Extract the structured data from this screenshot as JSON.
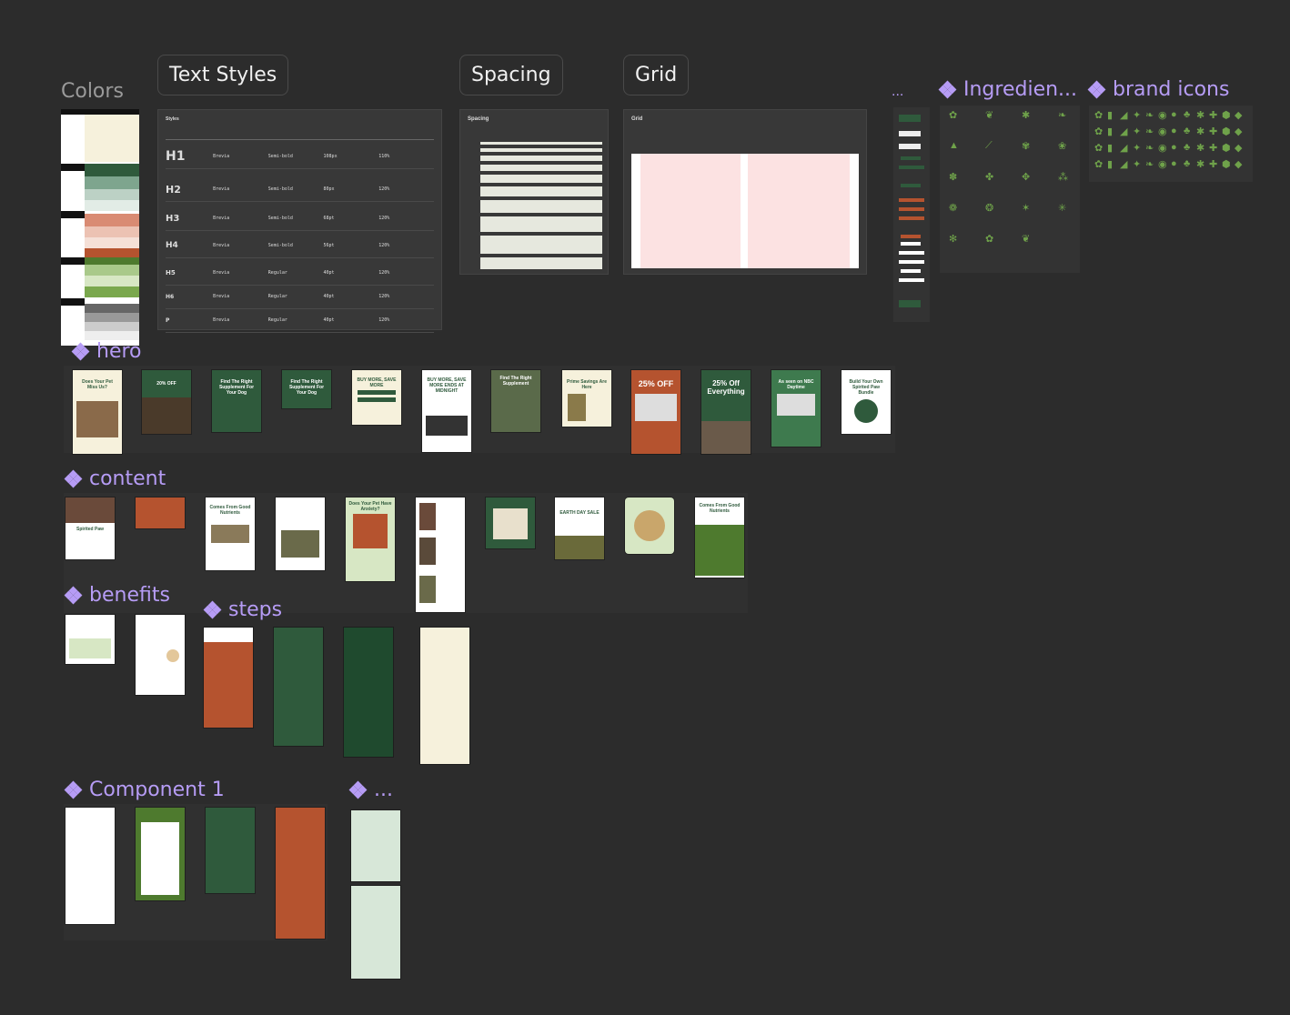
{
  "sections": {
    "colors": "Colors",
    "text_styles": "Text Styles",
    "spacing": "Spacing",
    "grid": "Grid",
    "more_top": "...",
    "ingredients": "Ingredien...",
    "brand_icons": "brand icons",
    "hero": "hero",
    "content": "content",
    "benefits": "benefits",
    "steps": "steps",
    "component1": "Component 1",
    "more_bottom": "..."
  },
  "text_styles_panel": {
    "title": "Styles",
    "rows": [
      {
        "name": "H1",
        "font": "Brevia",
        "weight": "Semi-bold",
        "size": "108px",
        "lh": "110%"
      },
      {
        "name": "H2",
        "font": "Brevia",
        "weight": "Semi-bold",
        "size": "80px",
        "lh": "120%"
      },
      {
        "name": "H3",
        "font": "Brevia",
        "weight": "Semi-bold",
        "size": "68pt",
        "lh": "120%"
      },
      {
        "name": "H4",
        "font": "Brevia",
        "weight": "Semi-bold",
        "size": "56pt",
        "lh": "120%"
      },
      {
        "name": "H5",
        "font": "Brevia",
        "weight": "Regular",
        "size": "40pt",
        "lh": "120%"
      },
      {
        "name": "H6",
        "font": "Brevia",
        "weight": "Regular",
        "size": "40pt",
        "lh": "120%"
      },
      {
        "name": "P",
        "font": "Brevia",
        "weight": "Regular",
        "size": "40pt",
        "lh": "120%"
      }
    ]
  },
  "spacing_panel": {
    "title": "Spacing"
  },
  "grid_panel": {
    "title": "Grid"
  },
  "hero_cards": [
    {
      "text": "Does Your Pet Miss Us?"
    },
    {
      "text": "20% OFF"
    },
    {
      "text": "Find The Right Supplement For Your Dog"
    },
    {
      "text": "Find The Right Supplement For Your Dog"
    },
    {
      "text": "BUY MORE, SAVE MORE"
    },
    {
      "text": "BUY MORE, SAVE MORE ENDS AT MIDNIGHT"
    },
    {
      "text": "Find The Right Supplement"
    },
    {
      "text": "Prime Savings Are Here"
    },
    {
      "text": "25% OFF"
    },
    {
      "text": "25% Off Everything"
    },
    {
      "text": "As seen on NBC Daytime"
    },
    {
      "text": "Build Your Own Spirited Paw Bundle"
    }
  ],
  "content_cards": [
    {
      "text": "Spirited Paw"
    },
    {
      "text": ""
    },
    {
      "text": "Comes From Good Nutrients"
    },
    {
      "text": ""
    },
    {
      "text": "Does Your Pet Have Anxiety?"
    },
    {
      "text": ""
    },
    {
      "text": ""
    },
    {
      "text": "EARTH DAY SALE"
    },
    {
      "text": ""
    },
    {
      "text": "Comes From Good Nutrients"
    }
  ],
  "colors": {
    "canvas": "#2c2c2c",
    "accent": "#b69cf5",
    "brand_green": "#2f5a3c",
    "brand_orange": "#b5532f",
    "brand_light": "#f6f1dc",
    "leaf_green": "#7aa84d"
  }
}
